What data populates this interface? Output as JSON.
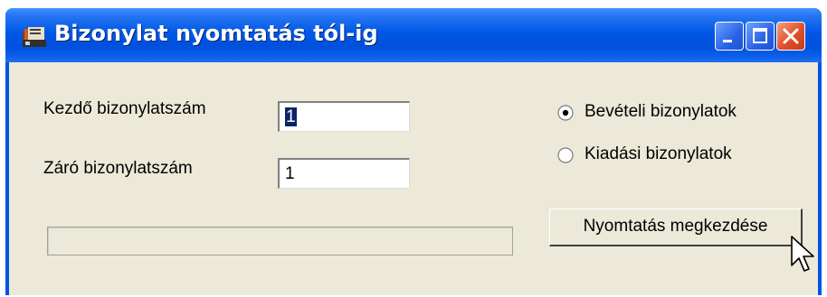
{
  "window": {
    "title": "Bizonylat nyomtatás tól-ig",
    "app_icon": "app-icon",
    "controls": [
      "minimize-icon",
      "maximize-icon",
      "close-icon"
    ]
  },
  "form": {
    "start_label": "Kezdő bizonylatszám",
    "start_value": "1",
    "end_label": "Záró bizonylatszám",
    "end_value": "1"
  },
  "options": {
    "income_label": "Bevételi bizonylatok",
    "income_selected": true,
    "expense_label": "Kiadási bizonylatok",
    "expense_selected": false
  },
  "progress": {
    "value": 0
  },
  "actions": {
    "print_label": "Nyomtatás megkezdése"
  },
  "colors": {
    "titlebar": "#0054e3",
    "client": "#ece9d8",
    "selection": "#0a246a",
    "close": "#e0502a"
  }
}
